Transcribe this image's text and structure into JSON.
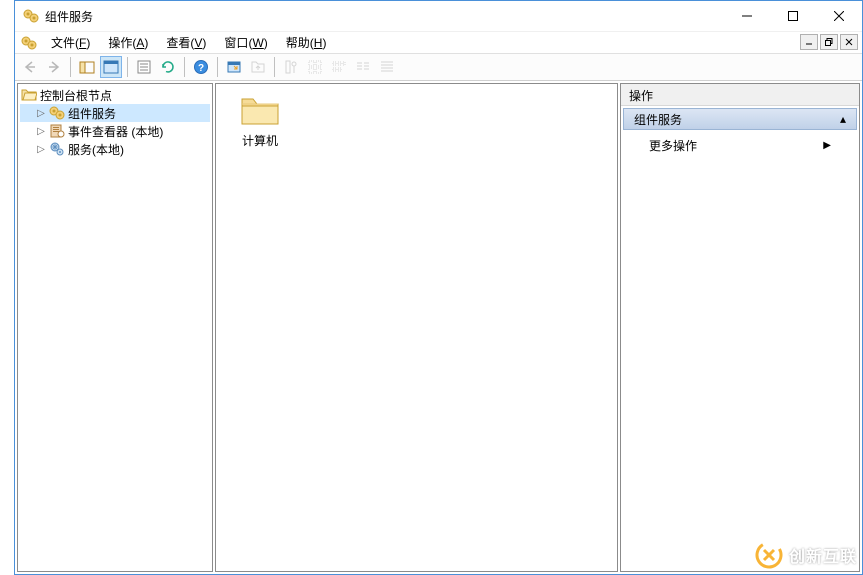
{
  "window": {
    "title": "组件服务"
  },
  "menu": {
    "items": [
      {
        "label": "文件",
        "key": "F"
      },
      {
        "label": "操作",
        "key": "A"
      },
      {
        "label": "查看",
        "key": "V"
      },
      {
        "label": "窗口",
        "key": "W"
      },
      {
        "label": "帮助",
        "key": "H"
      }
    ]
  },
  "tree": {
    "root": {
      "label": "控制台根节点",
      "icon": "folder-open"
    },
    "children": [
      {
        "label": "组件服务",
        "icon": "component",
        "selected": true
      },
      {
        "label": "事件查看器 (本地)",
        "icon": "event-viewer"
      },
      {
        "label": "服务(本地)",
        "icon": "services"
      }
    ]
  },
  "content": {
    "items": [
      {
        "label": "计算机",
        "icon": "folder"
      }
    ]
  },
  "actions": {
    "header": "操作",
    "section_title": "组件服务",
    "links": [
      {
        "label": "更多操作"
      }
    ]
  },
  "watermark": {
    "text": "创新互联"
  }
}
